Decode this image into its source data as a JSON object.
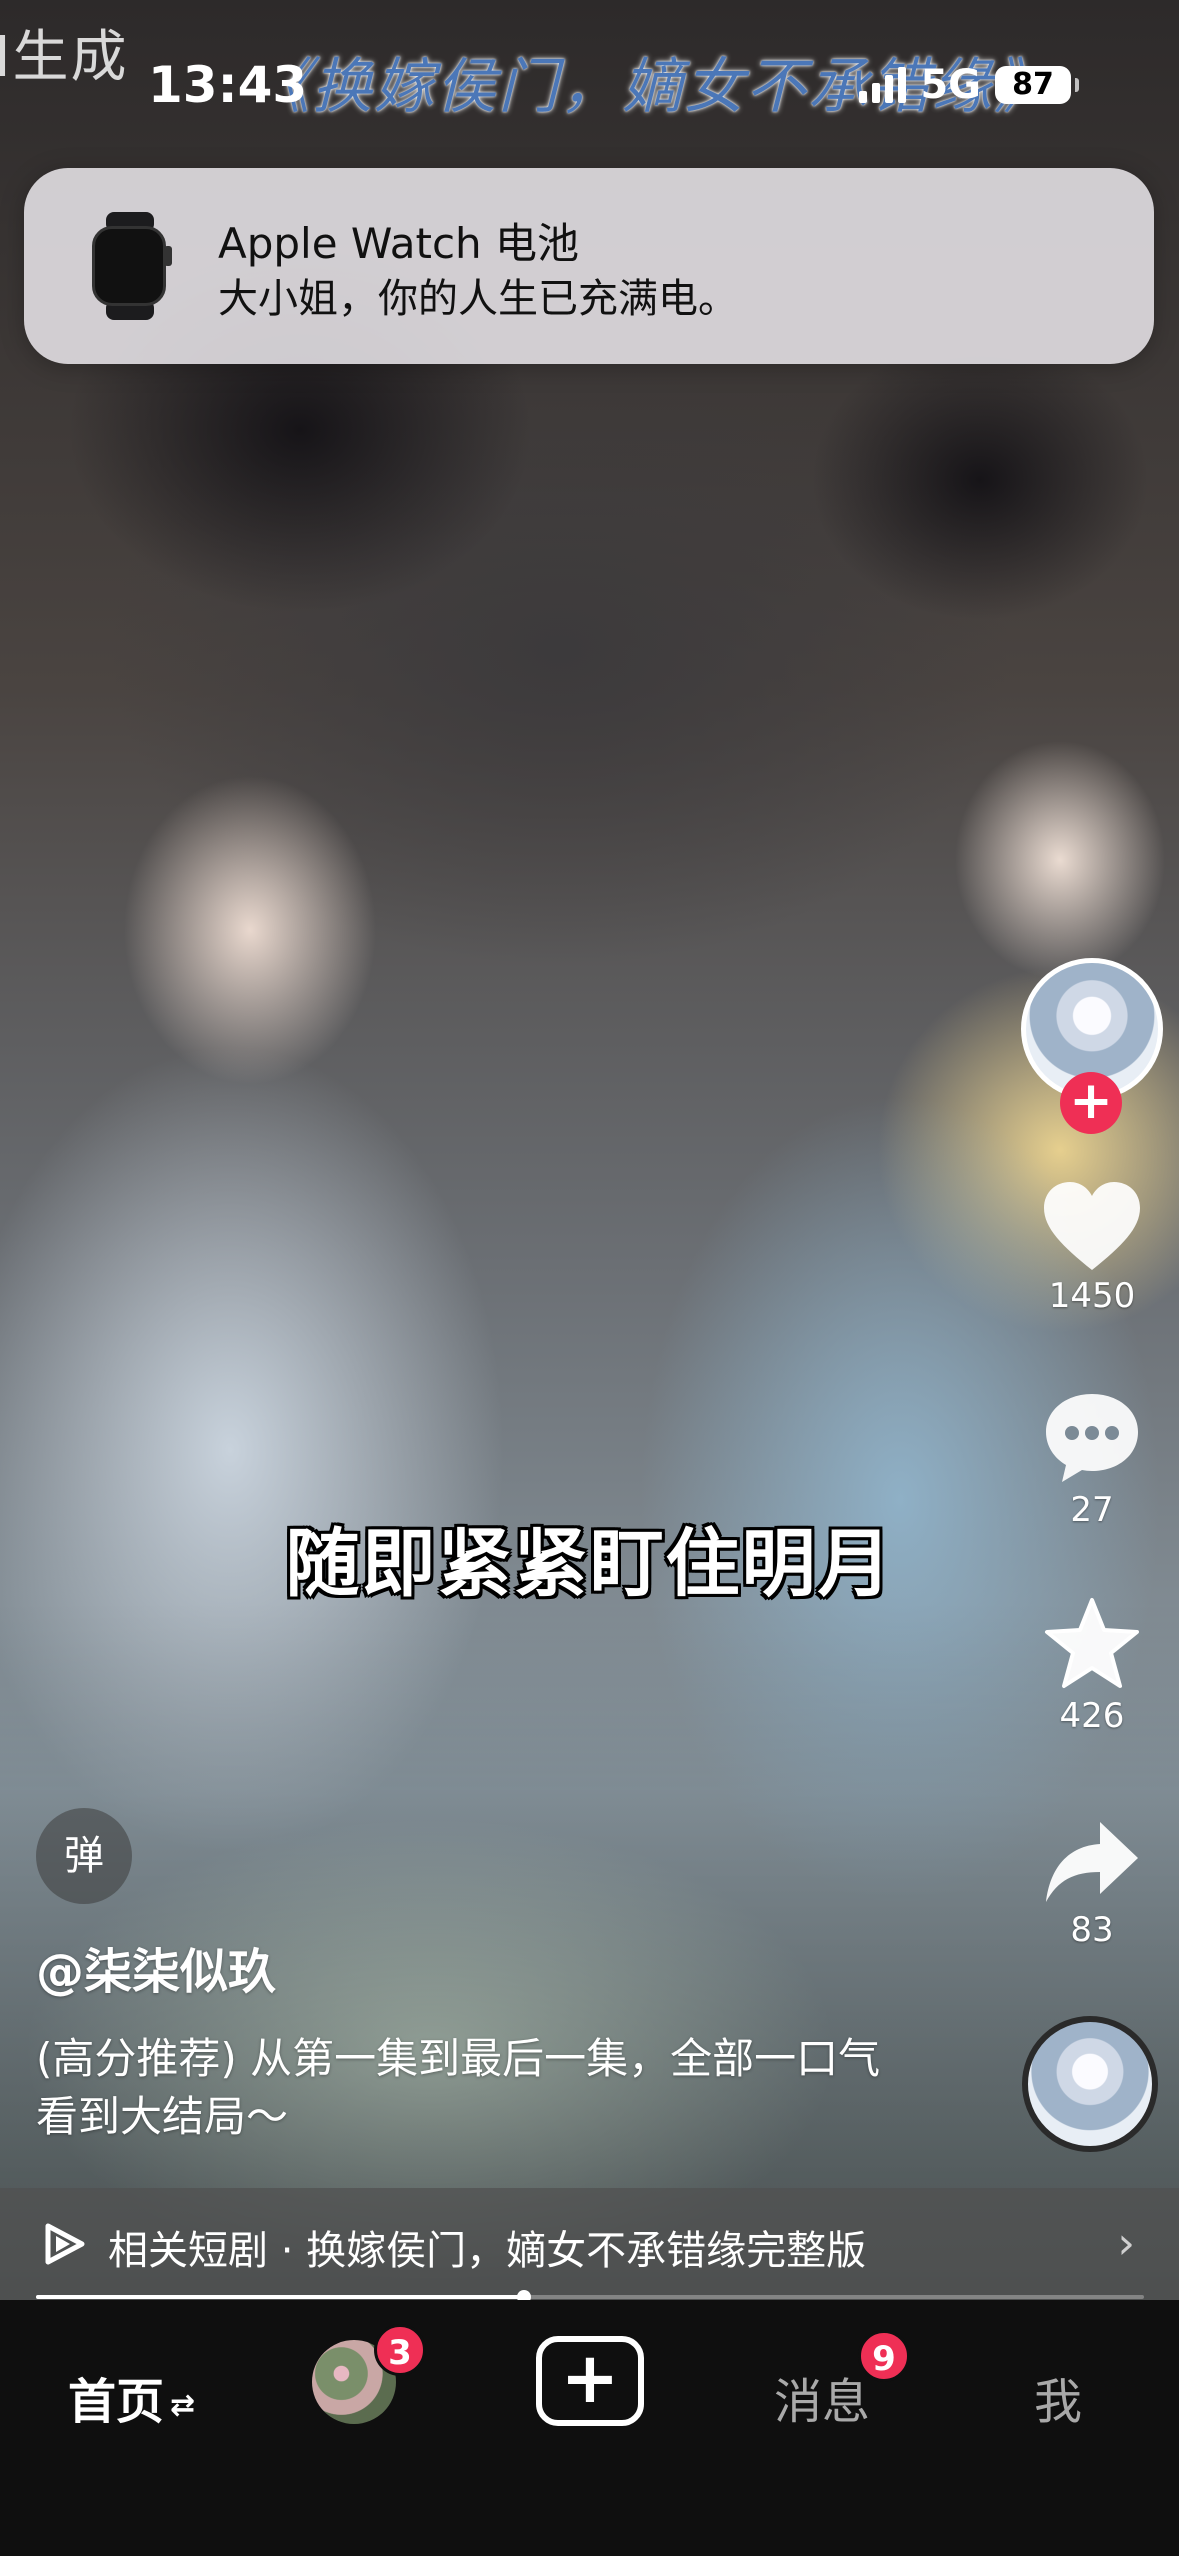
{
  "watermark": "I生成",
  "video_title": "《换嫁侯门，嫡女不承错缘》",
  "status_bar": {
    "time": "13:43",
    "network": "5G",
    "battery": "87"
  },
  "notification": {
    "app": "Apple Watch 电池",
    "message": "大小姐，你的人生已充满电。"
  },
  "subtitle": "随即紧紧盯住明月",
  "actions": {
    "follow_symbol": "+",
    "likes": "1450",
    "comments": "27",
    "favorites": "426",
    "shares": "83"
  },
  "danmaku_label": "弹",
  "author": "@柒柒似玖",
  "caption": "(高分推荐) 从第一集到最后一集，全部一口气看到大结局～",
  "related": {
    "label": "相关短剧 · 换嫁侯门，嫡女不承错缘完整版",
    "chevron": "›"
  },
  "playback_progress": 0.44,
  "tabs": {
    "home": "首页",
    "home_swap": "⇄",
    "friends_badge": "3",
    "create_symbol": "+",
    "messages": "消息",
    "messages_badge": "9",
    "me": "我"
  },
  "colors": {
    "accent_red": "#ef2f55",
    "title_blue": "#4b77b8",
    "tab_bar": "#0f0f0f"
  }
}
